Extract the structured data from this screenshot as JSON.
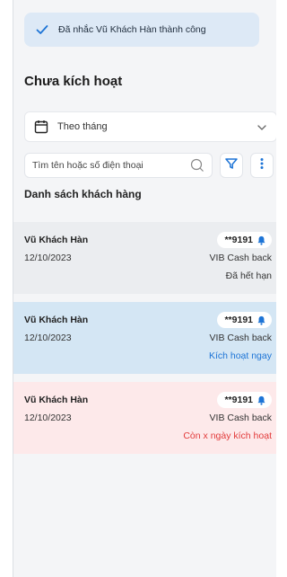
{
  "toast": {
    "message": "Đã nhắc Vũ Khách Hàn thành công"
  },
  "page": {
    "title": "Chưa kích hoạt"
  },
  "period_select": {
    "selected": "Theo tháng"
  },
  "search": {
    "placeholder": "Tìm tên hoặc số điện thoại"
  },
  "section": {
    "title": "Danh sách khách hàng"
  },
  "customers": [
    {
      "name": "Vũ Khách Hàn",
      "masked_number": "**9191",
      "date": "12/10/2023",
      "product": "VIB Cash back",
      "status": "Đã hết hạn"
    },
    {
      "name": "Vũ Khách Hàn",
      "masked_number": "**9191",
      "date": "12/10/2023",
      "product": "VIB Cash back",
      "status": "Kích hoạt ngay"
    },
    {
      "name": "Vũ Khách Hàn",
      "masked_number": "**9191",
      "date": "12/10/2023",
      "product": "VIB Cash back",
      "status": "Còn x ngày kích hoạt"
    }
  ],
  "colors": {
    "accent_blue": "#1d74d6",
    "alert_red": "#e23a3a",
    "card_grey": "#ebedf0",
    "card_blue": "#d4e6f4",
    "card_pink": "#fde9ea"
  },
  "icons": [
    "check-icon",
    "calendar-icon",
    "chevron-down-icon",
    "search-icon",
    "filter-icon",
    "more-vertical-icon",
    "bell-icon"
  ]
}
